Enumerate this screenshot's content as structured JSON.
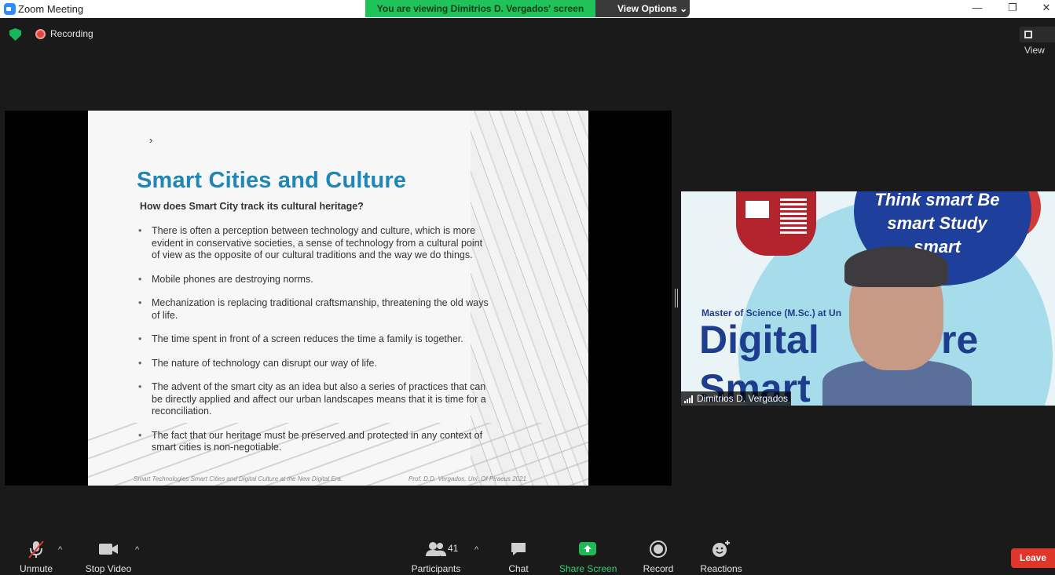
{
  "window": {
    "title": "Zoom Meeting",
    "minimize": "—",
    "restore": "❐",
    "close": "✕"
  },
  "banner": {
    "text": "You are viewing Dimitrios D. Vergados' screen",
    "view_options": "View Options ⌄"
  },
  "status": {
    "recording": "Recording",
    "view": "View"
  },
  "slide": {
    "title": "Smart Cities and Culture",
    "subtitle": "How does Smart City track its cultural heritage?",
    "bullets": [
      "There is often a perception between technology and culture, which is more evident in conservative societies, a sense of technology from a cultural point of view as the opposite of our cultural traditions and the way we do things.",
      "Mobile phones are destroying norms.",
      "Mechanization is replacing traditional craftsmanship, threatening the old ways of life.",
      "The time spent in front of a screen reduces the time a family is together.",
      "The nature of technology can disrupt our way of life.",
      "The advent of the smart city as an idea but also a series of practices that can be directly applied and affect our urban landscapes means that it is time for a reconciliation.",
      "The fact that our heritage must be preserved and protected in any context of smart cities is non-negotiable."
    ],
    "footer_left": "Smart Technologies Smart Cities and Digital Culture at the New Digital Era.",
    "footer_right": "Prof. D.D. Vergados, Uni. Of Piraeus 2021"
  },
  "video": {
    "participant_name": "Dimitrios D. Vergados",
    "motto": "Think smart Be smart Study smart",
    "program_line": "Master of Science (M.Sc.) at Un",
    "big_line_1": "Digital",
    "big_line_1_end": "re /",
    "big_line_2": "Smart C",
    "big_line_2_end": "/"
  },
  "toolbar": {
    "unmute": "Unmute",
    "stop_video": "Stop Video",
    "participants": "Participants",
    "participants_count": "41",
    "chat": "Chat",
    "share_screen": "Share Screen",
    "record": "Record",
    "reactions": "Reactions",
    "leave": "Leave"
  },
  "colors": {
    "banner_green": "#20c25a",
    "share_green": "#1db954",
    "leave_red": "#e0352b",
    "slide_title_blue": "#1f86b8"
  }
}
